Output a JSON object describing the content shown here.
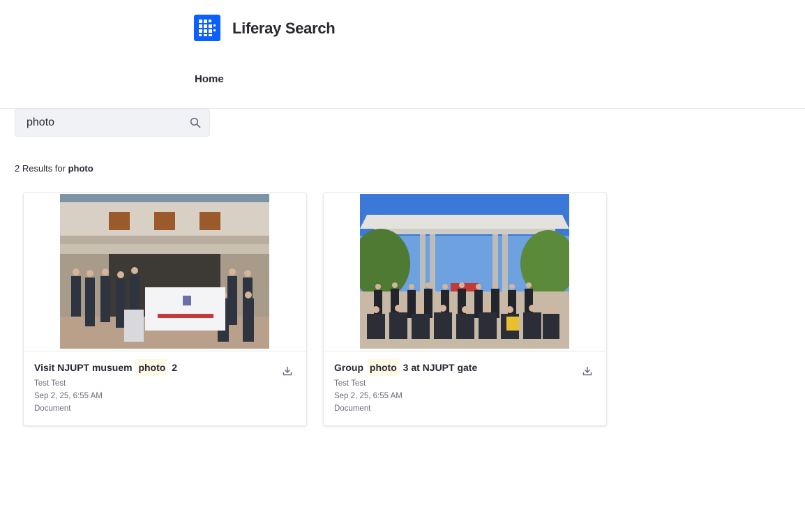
{
  "header": {
    "site_title": "Liferay Search",
    "logo_icon": "liferay-logo-icon",
    "brand_color": "#0b5fff"
  },
  "nav": {
    "items": [
      {
        "label": "Home"
      }
    ]
  },
  "search": {
    "value": "photo",
    "icon": "search-icon"
  },
  "results": {
    "count_prefix": "2 Results for ",
    "query": "photo",
    "items": [
      {
        "title_before": "Visit NJUPT musuem",
        "title_highlight": "photo",
        "title_after": "2",
        "author": "Test Test",
        "date": "Sep 2, 25, 6:55 AM",
        "type": "Document",
        "icon": "download-icon"
      },
      {
        "title_before": "Group",
        "title_highlight": "photo",
        "title_after": "3 at NJUPT gate",
        "author": "Test Test",
        "date": "Sep 2, 25, 6:55 AM",
        "type": "Document",
        "icon": "download-icon"
      }
    ]
  },
  "colors": {
    "highlight": "#fff8e5",
    "muted_text": "#6b6c7e",
    "border": "#e7e7ed"
  }
}
